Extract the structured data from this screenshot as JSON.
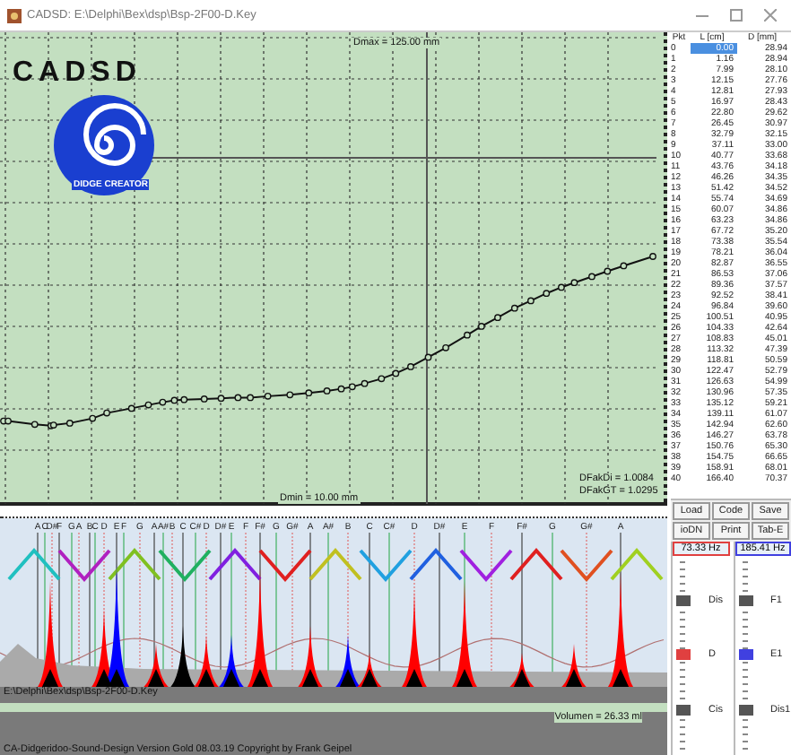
{
  "window": {
    "title": "CADSD: E:\\Delphi\\Bex\\dsp\\Bsp-2F00-D.Key"
  },
  "logo": {
    "name": "CADSD",
    "tagline": "DIDGE CREATOR"
  },
  "plot": {
    "dmax": "Dmax = 125.00 mm",
    "dmin": "Dmin = 10.00 mm",
    "factors": [
      "DFakDi = 1.0084",
      "DFakGT = 1.0295"
    ]
  },
  "table": {
    "columns": [
      "Pkt",
      "L [cm]",
      "D [mm]"
    ],
    "rows": [
      {
        "pkt": "0",
        "l": "0.00",
        "d": "28.94",
        "selected": true
      },
      {
        "pkt": "1",
        "l": "1.16",
        "d": "28.94",
        "selected": false
      },
      {
        "pkt": "2",
        "l": "7.99",
        "d": "28.10",
        "selected": false
      },
      {
        "pkt": "3",
        "l": "12.15",
        "d": "27.76",
        "selected": false
      },
      {
        "pkt": "4",
        "l": "12.81",
        "d": "27.93",
        "selected": false
      },
      {
        "pkt": "5",
        "l": "16.97",
        "d": "28.43",
        "selected": false
      },
      {
        "pkt": "6",
        "l": "22.80",
        "d": "29.62",
        "selected": false
      },
      {
        "pkt": "7",
        "l": "26.45",
        "d": "30.97",
        "selected": false
      },
      {
        "pkt": "8",
        "l": "32.79",
        "d": "32.15",
        "selected": false
      },
      {
        "pkt": "9",
        "l": "37.11",
        "d": "33.00",
        "selected": false
      },
      {
        "pkt": "10",
        "l": "40.77",
        "d": "33.68",
        "selected": false
      },
      {
        "pkt": "11",
        "l": "43.76",
        "d": "34.18",
        "selected": false
      },
      {
        "pkt": "12",
        "l": "46.26",
        "d": "34.35",
        "selected": false
      },
      {
        "pkt": "13",
        "l": "51.42",
        "d": "34.52",
        "selected": false
      },
      {
        "pkt": "14",
        "l": "55.74",
        "d": "34.69",
        "selected": false
      },
      {
        "pkt": "15",
        "l": "60.07",
        "d": "34.86",
        "selected": false
      },
      {
        "pkt": "16",
        "l": "63.23",
        "d": "34.86",
        "selected": false
      },
      {
        "pkt": "17",
        "l": "67.72",
        "d": "35.20",
        "selected": false
      },
      {
        "pkt": "18",
        "l": "73.38",
        "d": "35.54",
        "selected": false
      },
      {
        "pkt": "19",
        "l": "78.21",
        "d": "36.04",
        "selected": false
      },
      {
        "pkt": "20",
        "l": "82.87",
        "d": "36.55",
        "selected": false
      },
      {
        "pkt": "21",
        "l": "86.53",
        "d": "37.06",
        "selected": false
      },
      {
        "pkt": "22",
        "l": "89.36",
        "d": "37.57",
        "selected": false
      },
      {
        "pkt": "23",
        "l": "92.52",
        "d": "38.41",
        "selected": false
      },
      {
        "pkt": "24",
        "l": "96.84",
        "d": "39.60",
        "selected": false
      },
      {
        "pkt": "25",
        "l": "100.51",
        "d": "40.95",
        "selected": false
      },
      {
        "pkt": "26",
        "l": "104.33",
        "d": "42.64",
        "selected": false
      },
      {
        "pkt": "27",
        "l": "108.83",
        "d": "45.01",
        "selected": false
      },
      {
        "pkt": "28",
        "l": "113.32",
        "d": "47.39",
        "selected": false
      },
      {
        "pkt": "29",
        "l": "118.81",
        "d": "50.59",
        "selected": false
      },
      {
        "pkt": "30",
        "l": "122.47",
        "d": "52.79",
        "selected": false
      },
      {
        "pkt": "31",
        "l": "126.63",
        "d": "54.99",
        "selected": false
      },
      {
        "pkt": "32",
        "l": "130.96",
        "d": "57.35",
        "selected": false
      },
      {
        "pkt": "33",
        "l": "135.12",
        "d": "59.21",
        "selected": false
      },
      {
        "pkt": "34",
        "l": "139.11",
        "d": "61.07",
        "selected": false
      },
      {
        "pkt": "35",
        "l": "142.94",
        "d": "62.60",
        "selected": false
      },
      {
        "pkt": "36",
        "l": "146.27",
        "d": "63.78",
        "selected": false
      },
      {
        "pkt": "37",
        "l": "150.76",
        "d": "65.30",
        "selected": false
      },
      {
        "pkt": "38",
        "l": "154.75",
        "d": "66.65",
        "selected": false
      },
      {
        "pkt": "39",
        "l": "158.91",
        "d": "68.01",
        "selected": false
      },
      {
        "pkt": "40",
        "l": "166.40",
        "d": "70.37",
        "selected": false
      }
    ]
  },
  "spectrum": {
    "notes": [
      "A",
      "C",
      "D#",
      "F",
      "G",
      "A",
      "B",
      "C",
      "D",
      "E",
      "F",
      "G",
      "A",
      "A#",
      "B",
      "C",
      "C#",
      "D",
      "D#",
      "E",
      "F",
      "F#",
      "G",
      "G#",
      "A",
      "A#",
      "B",
      "C",
      "C#",
      "D",
      "D#",
      "E",
      "F",
      "F#",
      "G",
      "G#",
      "A"
    ],
    "file": "E:\\Delphi\\Bex\\dsp\\Bsp-2F00-D.Key",
    "volume": "Volumen = 26.33 ml"
  },
  "buttons": [
    "Load",
    "Code",
    "Save",
    "ioDN",
    "Print",
    "Tab-E"
  ],
  "scales": [
    {
      "frequency": "73.33 Hz",
      "color": "#e04040",
      "labels": [
        "Dis",
        "D",
        "Cis"
      ]
    },
    {
      "frequency": "185.41 Hz",
      "color": "#4040e0",
      "labels": [
        "F1",
        "E1",
        "Dis1"
      ]
    }
  ],
  "status": "CA-Didgeridoo-Sound-Design Version Gold 08.03.19 Copyright by Frank Geipel"
}
